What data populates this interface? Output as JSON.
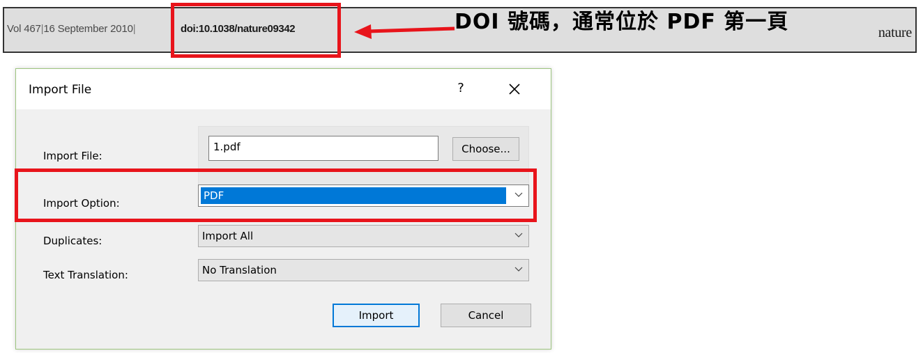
{
  "header": {
    "journal_ref": "Vol 467",
    "date": "16 September 2010",
    "doi": "doi:10.1038/nature09342",
    "brand": "nature"
  },
  "annotation": {
    "callout": "DOI 號碼，通常位於 PDF 第一頁",
    "highlight_color": "#e8141b"
  },
  "dialog": {
    "title": "Import File",
    "help_label": "?",
    "close_icon": "close-icon",
    "fields": {
      "import_file_label": "Import File:",
      "import_file_value": "1.pdf",
      "choose_label": "Choose...",
      "import_option_label": "Import Option:",
      "import_option_value": "PDF",
      "duplicates_label": "Duplicates:",
      "duplicates_value": "Import All",
      "text_translation_label": "Text Translation:",
      "text_translation_value": "No Translation"
    },
    "buttons": {
      "import": "Import",
      "cancel": "Cancel"
    },
    "accent_color": "#0078d7"
  }
}
